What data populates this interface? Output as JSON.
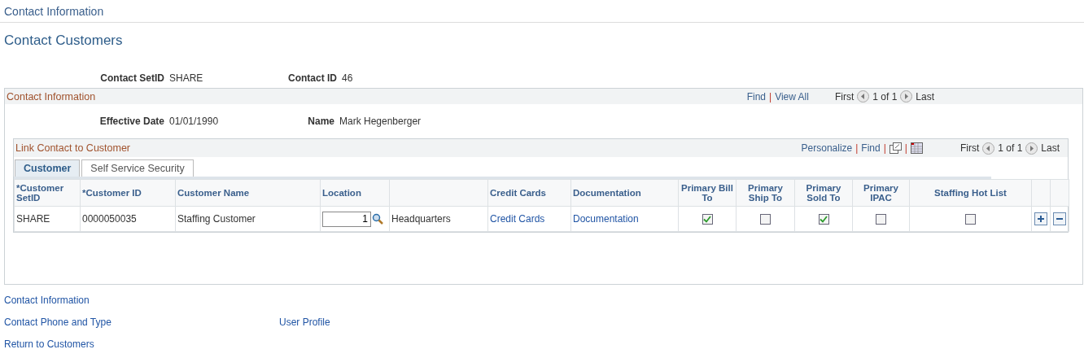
{
  "breadcrumb": "Contact Information",
  "title": "Contact Customers",
  "key_fields": [
    {
      "label": "Contact SetID",
      "value": "SHARE"
    },
    {
      "label": "Contact ID",
      "value": "46"
    }
  ],
  "panel": {
    "title": "Contact Information",
    "nav": {
      "separator": "|",
      "find": "Find",
      "view_all": "View All",
      "first": "First",
      "page": "1 of 1",
      "last": "Last"
    },
    "fields": [
      {
        "label": "Effective Date",
        "value": "01/01/1990"
      },
      {
        "label": "Name",
        "value": "Mark Hegenberger"
      }
    ],
    "grid": {
      "title": "Link Contact to Customer",
      "nav": {
        "separator": "|",
        "personalize": "Personalize",
        "find": "Find",
        "first": "First",
        "page": "1 of 1",
        "last": "Last"
      },
      "tabs": [
        {
          "label": "Customer",
          "selected": true
        },
        {
          "label": "Self Service Security",
          "selected": false
        }
      ],
      "columns": [
        {
          "label": "*Customer SetID"
        },
        {
          "label": "*Customer ID"
        },
        {
          "label": "Customer Name"
        },
        {
          "label": "Location"
        },
        {},
        {
          "label": "Credit Cards"
        },
        {
          "label": "Documentation"
        },
        {
          "label": "Primary Bill To"
        },
        {
          "label": "Primary Ship To"
        },
        {
          "label": "Primary Sold To"
        },
        {
          "label": "Primary IPAC"
        },
        {
          "label": "Staffing Hot List"
        }
      ],
      "rows": [
        {
          "cells": [
            {
              "kind": "text",
              "text": "SHARE"
            },
            {
              "kind": "text",
              "text": "0000050035"
            },
            {
              "kind": "text",
              "text": "Staffing Customer"
            },
            {
              "kind": "input",
              "value": "1"
            },
            {
              "kind": "text",
              "text": "Headquarters"
            },
            {
              "kind": "link",
              "text": "Credit Cards"
            },
            {
              "kind": "link",
              "text": "Documentation"
            },
            {
              "kind": "checkbox",
              "checked": true
            },
            {
              "kind": "checkbox",
              "checked": false
            },
            {
              "kind": "checkbox",
              "checked": true
            },
            {
              "kind": "checkbox",
              "checked": false
            },
            {
              "kind": "checkbox",
              "checked": false
            }
          ]
        }
      ]
    }
  },
  "links": [
    [
      "Contact Information"
    ],
    [
      "Contact Phone and Type",
      "User Profile"
    ],
    [
      "Return to Customers"
    ]
  ]
}
